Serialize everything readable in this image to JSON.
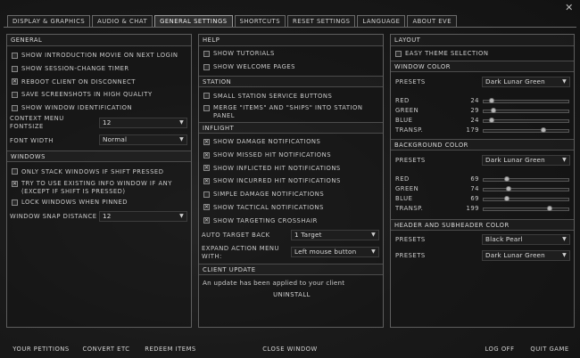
{
  "window": {
    "close_glyph": "✕"
  },
  "tabs": [
    {
      "label": "Display & Graphics",
      "active": false
    },
    {
      "label": "Audio & Chat",
      "active": false
    },
    {
      "label": "General Settings",
      "active": true
    },
    {
      "label": "Shortcuts",
      "active": false
    },
    {
      "label": "Reset Settings",
      "active": false
    },
    {
      "label": "Language",
      "active": false
    },
    {
      "label": "About EVE",
      "active": false
    }
  ],
  "left": {
    "general": {
      "title": "General",
      "options": [
        {
          "label": "Show introduction movie on next login",
          "checked": false
        },
        {
          "label": "Show session-change timer",
          "checked": false
        },
        {
          "label": "Reboot client on disconnect",
          "checked": true
        },
        {
          "label": "Save screenshots in high quality",
          "checked": false
        },
        {
          "label": "Show window identification",
          "checked": false
        }
      ],
      "context_menu_label_1": "Context menu",
      "context_menu_label_2": "fontsize",
      "context_menu_value": "12",
      "font_width_label": "Font width",
      "font_width_value": "Normal"
    },
    "windows": {
      "title": "Windows",
      "options": [
        {
          "label": "Only stack windows if shift pressed",
          "checked": false
        },
        {
          "label": "Try to use existing info window if any",
          "label2": "(except if shift is pressed)",
          "checked": true
        },
        {
          "label": "Lock windows when pinned",
          "checked": false
        }
      ],
      "snap_label": "Window snap distance",
      "snap_value": "12"
    }
  },
  "middle": {
    "help": {
      "title": "Help",
      "options": [
        {
          "label": "Show tutorials",
          "checked": false
        },
        {
          "label": "Show welcome pages",
          "checked": false
        }
      ]
    },
    "station": {
      "title": "Station",
      "options": [
        {
          "label": "Small station service buttons",
          "checked": false
        },
        {
          "label": "Merge \"items\" and \"ships\" into station",
          "label2": "panel",
          "checked": false
        }
      ]
    },
    "inflight": {
      "title": "Inflight",
      "options": [
        {
          "label": "Show damage notifications",
          "checked": true
        },
        {
          "label": "Show missed hit notifications",
          "checked": true
        },
        {
          "label": "Show inflicted hit notifications",
          "checked": true
        },
        {
          "label": "Show incurred hit notifications",
          "checked": true
        },
        {
          "label": "Simple damage notifications",
          "checked": false
        },
        {
          "label": "Show tactical notifications",
          "checked": true
        },
        {
          "label": "Show targeting crosshair",
          "checked": true
        }
      ],
      "auto_target_label": "Auto target back",
      "auto_target_value": "1 Target",
      "expand_label_1": "Expand action menu",
      "expand_label_2": "with:",
      "expand_value": "Left mouse button"
    },
    "client_update": {
      "title": "Client Update",
      "message": "An update has been applied to your client",
      "uninstall_label": "Uninstall"
    }
  },
  "right": {
    "layout": {
      "title": "Layout",
      "easy_theme_label": "Easy theme selection",
      "easy_theme_checked": false
    },
    "window_color": {
      "title": "Window Color",
      "presets_label": "Presets",
      "presets_value": "Dark Lunar Green",
      "channels": [
        {
          "name": "Red",
          "value": 24,
          "max": 255
        },
        {
          "name": "Green",
          "value": 29,
          "max": 255
        },
        {
          "name": "Blue",
          "value": 24,
          "max": 255
        },
        {
          "name": "Transp.",
          "value": 179,
          "max": 255
        }
      ]
    },
    "background_color": {
      "title": "Background Color",
      "presets_label": "Presets",
      "presets_value": "Dark Lunar Green",
      "channels": [
        {
          "name": "Red",
          "value": 69,
          "max": 255
        },
        {
          "name": "Green",
          "value": 74,
          "max": 255
        },
        {
          "name": "Blue",
          "value": 69,
          "max": 255
        },
        {
          "name": "Transp.",
          "value": 199,
          "max": 255
        }
      ]
    },
    "header_color": {
      "title": "Header and Subheader Color",
      "presets": [
        {
          "label": "Presets",
          "value": "Black Pearl"
        },
        {
          "label": "Presets",
          "value": "Dark Lunar Green"
        }
      ]
    }
  },
  "footer": {
    "your_petitions": "Your Petitions",
    "convert_etc": "Convert ETC",
    "redeem_items": "Redeem Items",
    "close_window": "Close Window",
    "log_off": "Log Off",
    "quit_game": "Quit Game"
  }
}
